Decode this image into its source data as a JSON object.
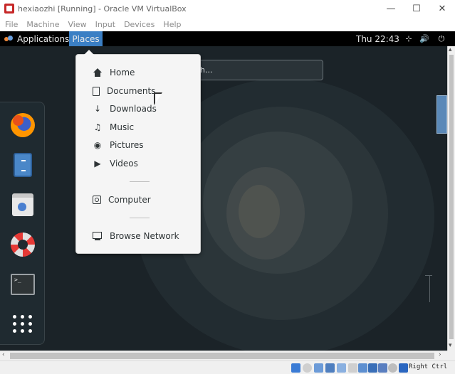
{
  "vbox": {
    "title": "hexiaozhi  [Running] - Oracle VM VirtualBox",
    "menu": [
      "File",
      "Machine",
      "View",
      "Input",
      "Devices",
      "Help"
    ],
    "controls": {
      "minimize": "—",
      "maximize": "☐",
      "close": "✕"
    },
    "host_key": "Right Ctrl"
  },
  "gnome": {
    "applications_label": "Applications",
    "places_label": "Places",
    "clock": "Thu 22:43",
    "tray": {
      "network": "⊹",
      "volume": "🔊",
      "power": "⏻"
    }
  },
  "search": {
    "partial_text": "h..."
  },
  "places_menu": {
    "items": [
      {
        "label": "Home",
        "icon": "home-icon"
      },
      {
        "label": "Documents",
        "icon": "document-icon"
      },
      {
        "label": "Downloads",
        "icon": "download-icon"
      },
      {
        "label": "Music",
        "icon": "music-icon"
      },
      {
        "label": "Pictures",
        "icon": "camera-icon"
      },
      {
        "label": "Videos",
        "icon": "video-icon"
      },
      {
        "label": "Computer",
        "icon": "computer-icon"
      },
      {
        "label": "Browse Network",
        "icon": "network-icon"
      }
    ],
    "glyphs": {
      "download": "↓",
      "music": "♫",
      "camera": "◉",
      "video": "▶"
    }
  },
  "dash": {
    "apps": [
      "firefox",
      "files",
      "software",
      "help",
      "terminal",
      "show-applications"
    ],
    "terminal_prompt": ">_"
  },
  "colors": {
    "places_highlight": "#3b7fc4",
    "desktop_background": "#1b2328",
    "menu_background": "#f5f5f5"
  }
}
